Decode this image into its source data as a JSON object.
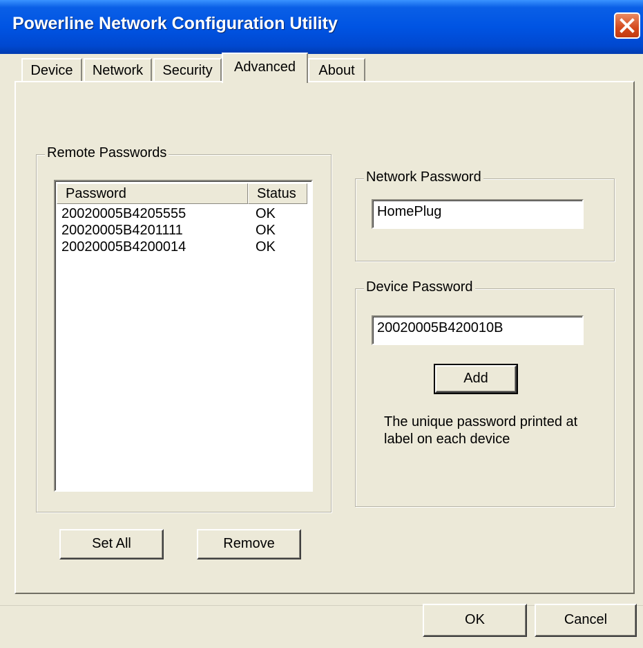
{
  "window": {
    "title": "Powerline Network Configuration Utility"
  },
  "tabs": [
    {
      "label": "Device"
    },
    {
      "label": "Network"
    },
    {
      "label": "Security"
    },
    {
      "label": "Advanced"
    },
    {
      "label": "About"
    }
  ],
  "active_tab": "Advanced",
  "remote_passwords": {
    "group_label": "Remote Passwords",
    "columns": [
      "Password",
      "Status"
    ],
    "rows": [
      {
        "password": "20020005B4205555",
        "status": "OK"
      },
      {
        "password": "20020005B4201111",
        "status": "OK"
      },
      {
        "password": "20020005B4200014",
        "status": "OK"
      }
    ],
    "set_all_label": "Set All",
    "remove_label": "Remove"
  },
  "network_password": {
    "group_label": "Network Password",
    "value": "HomePlug"
  },
  "device_password": {
    "group_label": "Device Password",
    "value": "20020005B420010B",
    "add_label": "Add",
    "hint": "The unique password printed at label on each device"
  },
  "dialog_buttons": {
    "ok": "OK",
    "cancel": "Cancel"
  }
}
